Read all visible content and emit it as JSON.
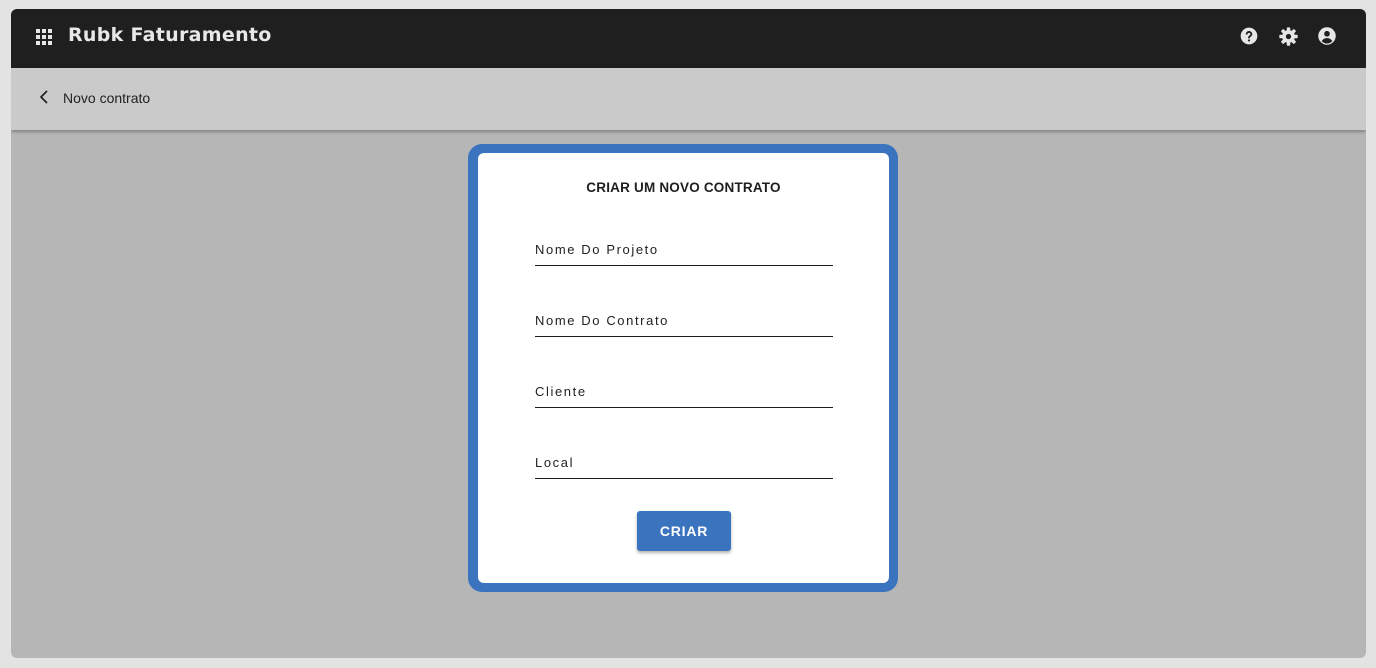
{
  "app": {
    "title": "Rubk Faturamento",
    "icons": [
      "apps-grid-icon",
      "help-icon",
      "gear-icon",
      "account-circle-icon"
    ]
  },
  "subbar": {
    "back_icon": "chevron-left-icon",
    "title": "Novo contrato"
  },
  "form": {
    "title": "CRIAR UM NOVO CONTRATO",
    "fields": [
      {
        "placeholder": "Nome Do Projeto",
        "value": ""
      },
      {
        "placeholder": "Nome Do Contrato",
        "value": ""
      },
      {
        "placeholder": "Cliente",
        "value": ""
      },
      {
        "placeholder": "Local",
        "value": ""
      }
    ],
    "submit_label": "CRIAR"
  },
  "colors": {
    "appbar": "#1f1f1f",
    "subbar": "#cacaca",
    "background": "#b6b6b6",
    "accent": "#3a74bf",
    "card": "#ffffff"
  }
}
